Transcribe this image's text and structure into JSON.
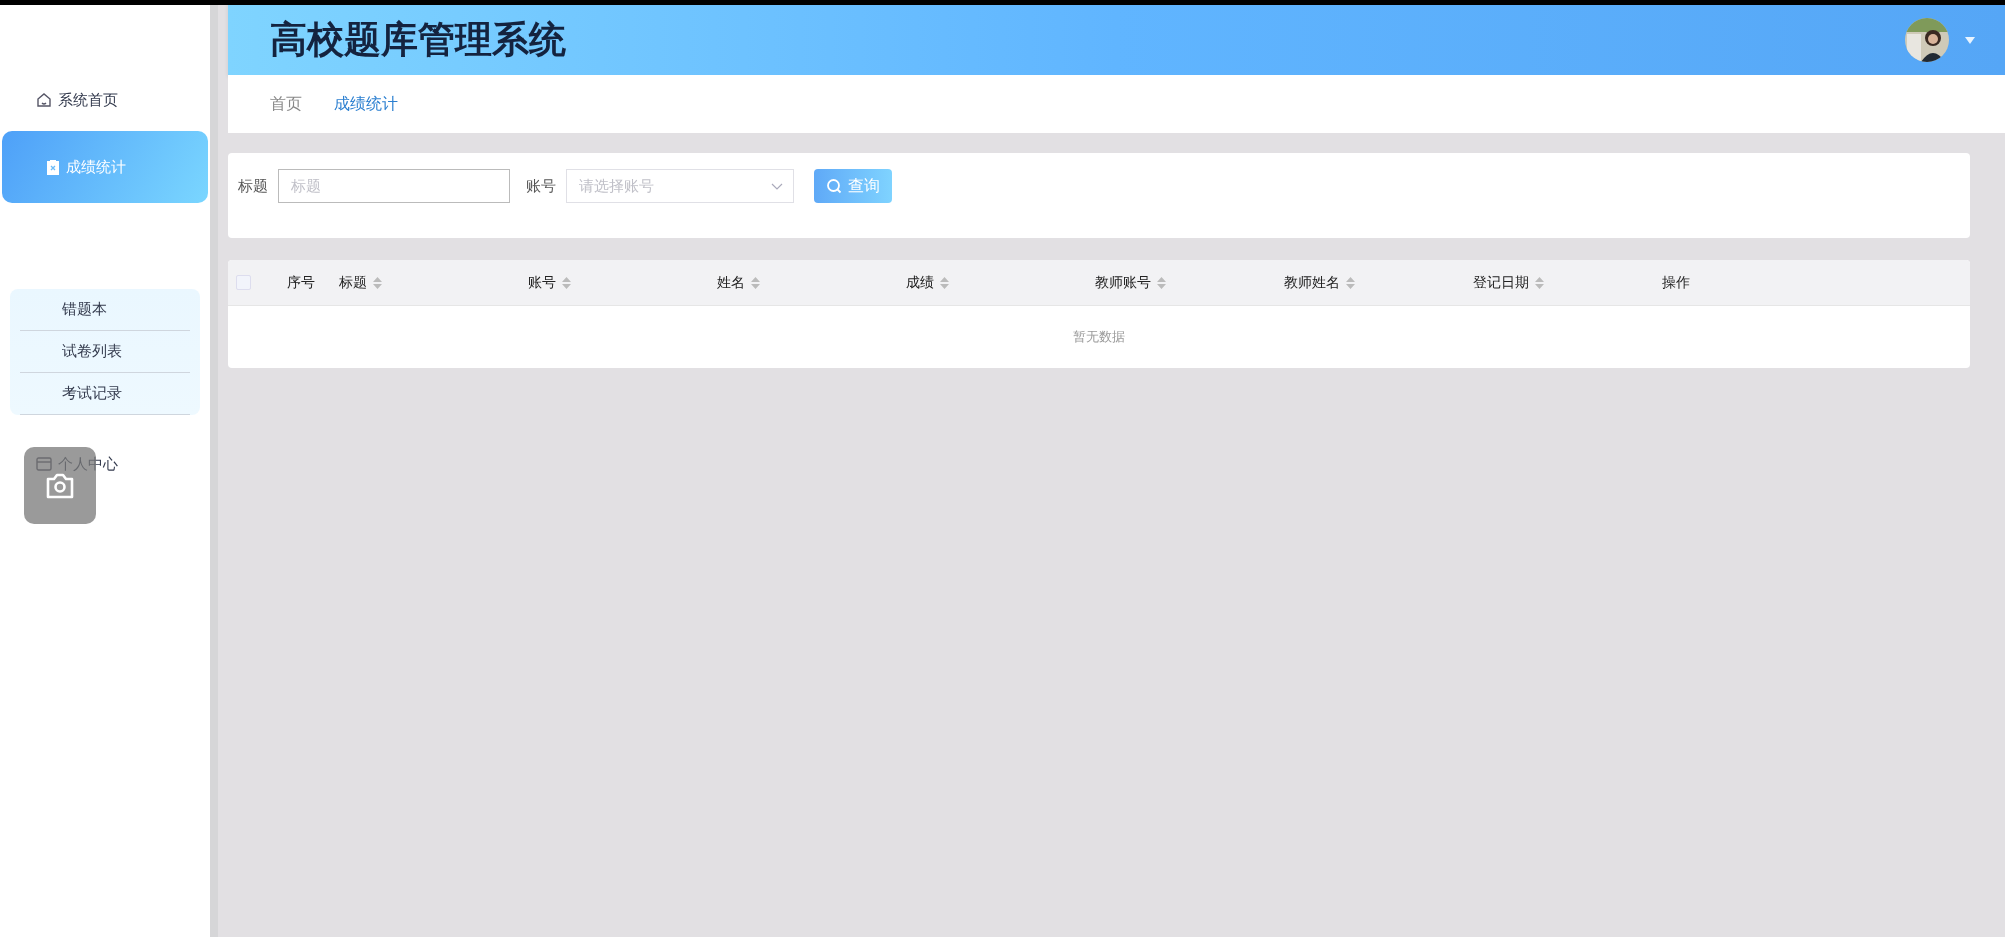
{
  "header": {
    "title": "高校题库管理系统"
  },
  "sidebar": {
    "items": [
      {
        "label": "系统首页",
        "selected": false
      },
      {
        "label": "成绩统计",
        "selected": true
      }
    ],
    "submenu": [
      {
        "label": "错题本",
        "selected": false
      },
      {
        "label": "试卷列表",
        "selected": false
      },
      {
        "label": "考试记录",
        "selected": false
      }
    ],
    "bottom_items": [
      {
        "label": "个人中心",
        "selected": false
      }
    ]
  },
  "breadcrumb": [
    {
      "label": "首页",
      "selected": false
    },
    {
      "label": "成绩统计",
      "selected": true
    }
  ],
  "search": {
    "fields": [
      {
        "kind": "input",
        "label": "标题",
        "placeholder": "标题"
      },
      {
        "kind": "select",
        "label": "账号",
        "placeholder": "请选择账号"
      }
    ],
    "button": "查询"
  },
  "table": {
    "select_all": {
      "checked": false
    },
    "columns": [
      {
        "label": "序号",
        "sortable": false
      },
      {
        "label": "标题",
        "sortable": true
      },
      {
        "label": "账号",
        "sortable": true
      },
      {
        "label": "姓名",
        "sortable": true
      },
      {
        "label": "成绩",
        "sortable": true
      },
      {
        "label": "教师账号",
        "sortable": true
      },
      {
        "label": "教师姓名",
        "sortable": true
      },
      {
        "label": "登记日期",
        "sortable": true
      },
      {
        "label": "操作",
        "sortable": false
      }
    ],
    "empty_text": "暂无数据"
  }
}
